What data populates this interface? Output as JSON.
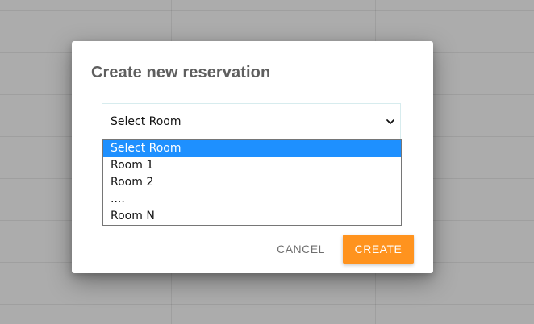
{
  "dialog": {
    "title": "Create new reservation"
  },
  "room_select": {
    "selected": "Select Room",
    "options": [
      "Select Room",
      "Room 1",
      "Room 2",
      "....",
      "Room N"
    ],
    "highlighted_index": 0
  },
  "actions": {
    "cancel_label": "CANCEL",
    "create_label": "CREATE"
  },
  "colors": {
    "accent": "#ff931e",
    "selection": "#1e90ff",
    "backdrop": "#acacac"
  }
}
